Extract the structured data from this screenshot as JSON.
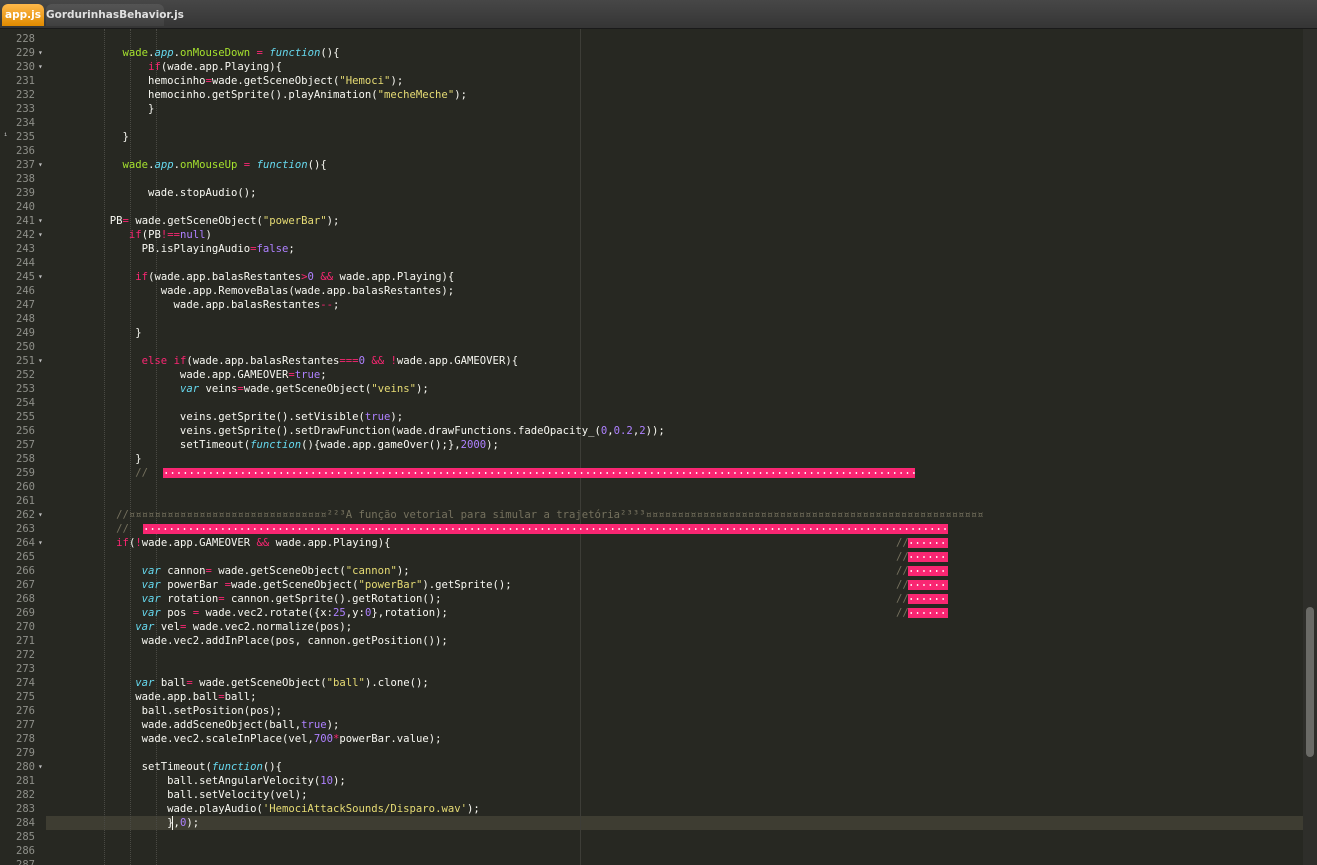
{
  "tabs": [
    {
      "label": "app.js",
      "active": true
    },
    {
      "label": "GordurinhasBehavior.js",
      "active": false
    }
  ],
  "colors": {
    "accent": "#ffb84a",
    "editor_bg": "#272822",
    "highlight": "#f92672"
  },
  "editor": {
    "current_line": 284,
    "lines": [
      {
        "n": 228,
        "t": ""
      },
      {
        "n": 229,
        "t": "            wade.app.onMouseDown = function(){"
      },
      {
        "n": 230,
        "t": "                if(wade.app.Playing){"
      },
      {
        "n": 231,
        "t": "                hemocinho=wade.getSceneObject(\"Hemoci\");"
      },
      {
        "n": 232,
        "t": "                hemocinho.getSprite().playAnimation(\"mecheMeche\");"
      },
      {
        "n": 233,
        "t": "                }"
      },
      {
        "n": 234,
        "t": ""
      },
      {
        "n": 235,
        "t": "            }"
      },
      {
        "n": 236,
        "t": ""
      },
      {
        "n": 237,
        "t": "            wade.app.onMouseUp = function(){"
      },
      {
        "n": 238,
        "t": ""
      },
      {
        "n": 239,
        "t": "                wade.stopAudio();"
      },
      {
        "n": 240,
        "t": ""
      },
      {
        "n": 241,
        "t": "          PB= wade.getSceneObject(\"powerBar\");"
      },
      {
        "n": 242,
        "t": "             if(PB!==null)"
      },
      {
        "n": 243,
        "t": "               PB.isPlayingAudio=false;"
      },
      {
        "n": 244,
        "t": ""
      },
      {
        "n": 245,
        "t": "              if(wade.app.balasRestantes>0 && wade.app.Playing){"
      },
      {
        "n": 246,
        "t": "                  wade.app.RemoveBalas(wade.app.balasRestantes);"
      },
      {
        "n": 247,
        "t": "                    wade.app.balasRestantes--;"
      },
      {
        "n": 248,
        "t": ""
      },
      {
        "n": 249,
        "t": "              }"
      },
      {
        "n": 250,
        "t": ""
      },
      {
        "n": 251,
        "t": "               else if(wade.app.balasRestantes===0 && !wade.app.GAMEOVER){"
      },
      {
        "n": 252,
        "t": "                     wade.app.GAMEOVER=true;"
      },
      {
        "n": 253,
        "t": "                     var veins=wade.getSceneObject(\"veins\");"
      },
      {
        "n": 254,
        "t": ""
      },
      {
        "n": 255,
        "t": "                     veins.getSprite().setVisible(true);"
      },
      {
        "n": 256,
        "t": "                     veins.getSprite().setDrawFunction(wade.drawFunctions.fadeOpacity_(0,0.2,2));"
      },
      {
        "n": 257,
        "t": "                     setTimeout(function(){wade.app.gameOver();},2000);"
      },
      {
        "n": 258,
        "t": "              }"
      },
      {
        "n": 259,
        "t": "              //"
      },
      {
        "n": 260,
        "t": ""
      },
      {
        "n": 261,
        "t": ""
      },
      {
        "n": 262,
        "t": "           //¤¤¤¤¤¤¤¤¤¤¤¤¤¤¤¤¤¤¤¤¤¤¤¤¤¤¤¤¤¤¤²²³A função vetorial para simular a trajetória²³³³¤¤¤¤¤¤¤¤¤¤¤¤¤¤¤¤¤¤¤¤¤¤¤¤¤¤¤¤¤¤¤¤¤¤¤¤¤¤¤¤¤¤¤¤¤¤¤¤¤¤¤¤¤"
      },
      {
        "n": 263,
        "t": "           //"
      },
      {
        "n": 264,
        "t": "           if(!wade.app.GAMEOVER && wade.app.Playing){"
      },
      {
        "n": 265,
        "t": ""
      },
      {
        "n": 266,
        "t": "               var cannon= wade.getSceneObject(\"cannon\");"
      },
      {
        "n": 267,
        "t": "               var powerBar =wade.getSceneObject(\"powerBar\").getSprite();"
      },
      {
        "n": 268,
        "t": "               var rotation= cannon.getSprite().getRotation();"
      },
      {
        "n": 269,
        "t": "               var pos = wade.vec2.rotate({x:25,y:0},rotation);"
      },
      {
        "n": 270,
        "t": "              var vel= wade.vec2.normalize(pos);"
      },
      {
        "n": 271,
        "t": "               wade.vec2.addInPlace(pos, cannon.getPosition());"
      },
      {
        "n": 272,
        "t": ""
      },
      {
        "n": 273,
        "t": ""
      },
      {
        "n": 274,
        "t": "              var ball= wade.getSceneObject(\"ball\").clone();"
      },
      {
        "n": 275,
        "t": "              wade.app.ball=ball;"
      },
      {
        "n": 276,
        "t": "               ball.setPosition(pos);"
      },
      {
        "n": 277,
        "t": "               wade.addSceneObject(ball,true);"
      },
      {
        "n": 278,
        "t": "               wade.vec2.scaleInPlace(vel,700*powerBar.value);"
      },
      {
        "n": 279,
        "t": ""
      },
      {
        "n": 280,
        "t": "               setTimeout(function(){"
      },
      {
        "n": 281,
        "t": "                   ball.setAngularVelocity(10);"
      },
      {
        "n": 282,
        "t": "                   ball.setVelocity(vel);"
      },
      {
        "n": 283,
        "t": "                   wade.playAudio('HemociAttackSounds/Disparo.wav');"
      },
      {
        "n": 284,
        "t": "                   },0);"
      },
      {
        "n": 285,
        "t": ""
      },
      {
        "n": 286,
        "t": ""
      },
      {
        "n": 287,
        "t": ""
      }
    ],
    "side_comments": [
      "//",
      "//",
      "//",
      "//",
      "//",
      "//"
    ]
  }
}
